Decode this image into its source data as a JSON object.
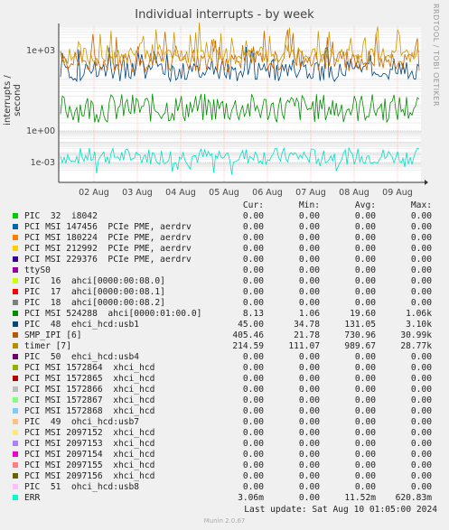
{
  "title": "Individual interrupts - by week",
  "side_label": "RRDTOOL / TOBI OETIKER",
  "chart_data": {
    "type": "line",
    "title": "Individual interrupts - by week",
    "ylabel": "interrupts / second",
    "y_scale": "log",
    "y_ticks": [
      "1e+03",
      "1e+00",
      "1e-03"
    ],
    "x_ticks": [
      "02 Aug",
      "03 Aug",
      "04 Aug",
      "05 Aug",
      "06 Aug",
      "07 Aug",
      "08 Aug",
      "09 Aug"
    ],
    "grid": true,
    "series_colors": {
      "timer [7]": "#cc9900",
      "SMP_IPI [6]": "#cc6600",
      "PIC  48  ehci_hcd:usb1": "#00457f",
      "PCI MSI 524288  ahci[0000:01:00.0]": "#008f00",
      "ERR": "#00e0c8"
    }
  },
  "legend_header": {
    "cur": "Cur:",
    "min": "Min:",
    "avg": "Avg:",
    "max": "Max:"
  },
  "legend": [
    {
      "name": "PIC  32  i8042",
      "color": "#00cc00",
      "cur": "0.00",
      "min": "0.00",
      "avg": "0.00",
      "max": "0.00"
    },
    {
      "name": "PCI MSI 147456  PCIe PME, aerdrv",
      "color": "#0066b3",
      "cur": "0.00",
      "min": "0.00",
      "avg": "0.00",
      "max": "0.00"
    },
    {
      "name": "PCI MSI 180224  PCIe PME, aerdrv",
      "color": "#ff8000",
      "cur": "0.00",
      "min": "0.00",
      "avg": "0.00",
      "max": "0.00"
    },
    {
      "name": "PCI MSI 212992  PCIe PME, aerdrv",
      "color": "#ffcc00",
      "cur": "0.00",
      "min": "0.00",
      "avg": "0.00",
      "max": "0.00"
    },
    {
      "name": "PCI MSI 229376  PCIe PME, aerdrv",
      "color": "#330099",
      "cur": "0.00",
      "min": "0.00",
      "avg": "0.00",
      "max": "0.00"
    },
    {
      "name": "ttyS0",
      "color": "#990099",
      "cur": "0.00",
      "min": "0.00",
      "avg": "0.00",
      "max": "0.00"
    },
    {
      "name": "PIC  16  ahci[0000:00:08.0]",
      "color": "#ccff00",
      "cur": "0.00",
      "min": "0.00",
      "avg": "0.00",
      "max": "0.00"
    },
    {
      "name": "PIC  17  ahci[0000:00:08.1]",
      "color": "#ff0000",
      "cur": "0.00",
      "min": "0.00",
      "avg": "0.00",
      "max": "0.00"
    },
    {
      "name": "PIC  18  ahci[0000:00:08.2]",
      "color": "#808080",
      "cur": "0.00",
      "min": "0.00",
      "avg": "0.00",
      "max": "0.00"
    },
    {
      "name": "PCI MSI 524288  ahci[0000:01:00.0]",
      "color": "#008f00",
      "cur": "8.13",
      "min": "1.06",
      "avg": "19.60",
      "max": "1.06k"
    },
    {
      "name": "PIC  48  ehci_hcd:usb1",
      "color": "#00487d",
      "cur": "45.00",
      "min": "34.78",
      "avg": "131.05",
      "max": "3.10k"
    },
    {
      "name": "SMP_IPI [6]",
      "color": "#b35a00",
      "cur": "405.46",
      "min": "21.78",
      "avg": "730.96",
      "max": "30.99k"
    },
    {
      "name": "timer [7]",
      "color": "#b38f00",
      "cur": "214.59",
      "min": "111.07",
      "avg": "989.67",
      "max": "28.77k"
    },
    {
      "name": "PIC  50  ehci_hcd:usb4",
      "color": "#6b006b",
      "cur": "0.00",
      "min": "0.00",
      "avg": "0.00",
      "max": "0.00"
    },
    {
      "name": "PCI MSI 1572864  xhci_hcd",
      "color": "#8fb300",
      "cur": "0.00",
      "min": "0.00",
      "avg": "0.00",
      "max": "0.00"
    },
    {
      "name": "PCI MSI 1572865  xhci_hcd",
      "color": "#b30000",
      "cur": "0.00",
      "min": "0.00",
      "avg": "0.00",
      "max": "0.00"
    },
    {
      "name": "PCI MSI 1572866  xhci_hcd",
      "color": "#bebebe",
      "cur": "0.00",
      "min": "0.00",
      "avg": "0.00",
      "max": "0.00"
    },
    {
      "name": "PCI MSI 1572867  xhci_hcd",
      "color": "#80ff80",
      "cur": "0.00",
      "min": "0.00",
      "avg": "0.00",
      "max": "0.00"
    },
    {
      "name": "PCI MSI 1572868  xhci_hcd",
      "color": "#80c9ff",
      "cur": "0.00",
      "min": "0.00",
      "avg": "0.00",
      "max": "0.00"
    },
    {
      "name": "PIC  49  ohci_hcd:usb7",
      "color": "#ffc080",
      "cur": "0.00",
      "min": "0.00",
      "avg": "0.00",
      "max": "0.00"
    },
    {
      "name": "PCI MSI 2097152  xhci_hcd",
      "color": "#ffe680",
      "cur": "0.00",
      "min": "0.00",
      "avg": "0.00",
      "max": "0.00"
    },
    {
      "name": "PCI MSI 2097153  xhci_hcd",
      "color": "#aa80ff",
      "cur": "0.00",
      "min": "0.00",
      "avg": "0.00",
      "max": "0.00"
    },
    {
      "name": "PCI MSI 2097154  xhci_hcd",
      "color": "#ee00cc",
      "cur": "0.00",
      "min": "0.00",
      "avg": "0.00",
      "max": "0.00"
    },
    {
      "name": "PCI MSI 2097155  xhci_hcd",
      "color": "#ff8080",
      "cur": "0.00",
      "min": "0.00",
      "avg": "0.00",
      "max": "0.00"
    },
    {
      "name": "PCI MSI 2097156  xhci_hcd",
      "color": "#666600",
      "cur": "0.00",
      "min": "0.00",
      "avg": "0.00",
      "max": "0.00"
    },
    {
      "name": "PIC  51  ohci_hcd:usb8",
      "color": "#ffbfff",
      "cur": "0.00",
      "min": "0.00",
      "avg": "0.00",
      "max": "0.00"
    },
    {
      "name": "ERR",
      "color": "#00ffcc",
      "cur": "3.06m",
      "min": "0.00",
      "avg": "11.52m",
      "max": "620.83m"
    }
  ],
  "last_update": "Last update: Sat Aug 10 01:05:00 2024",
  "munin_version": "Munin 2.0.67"
}
